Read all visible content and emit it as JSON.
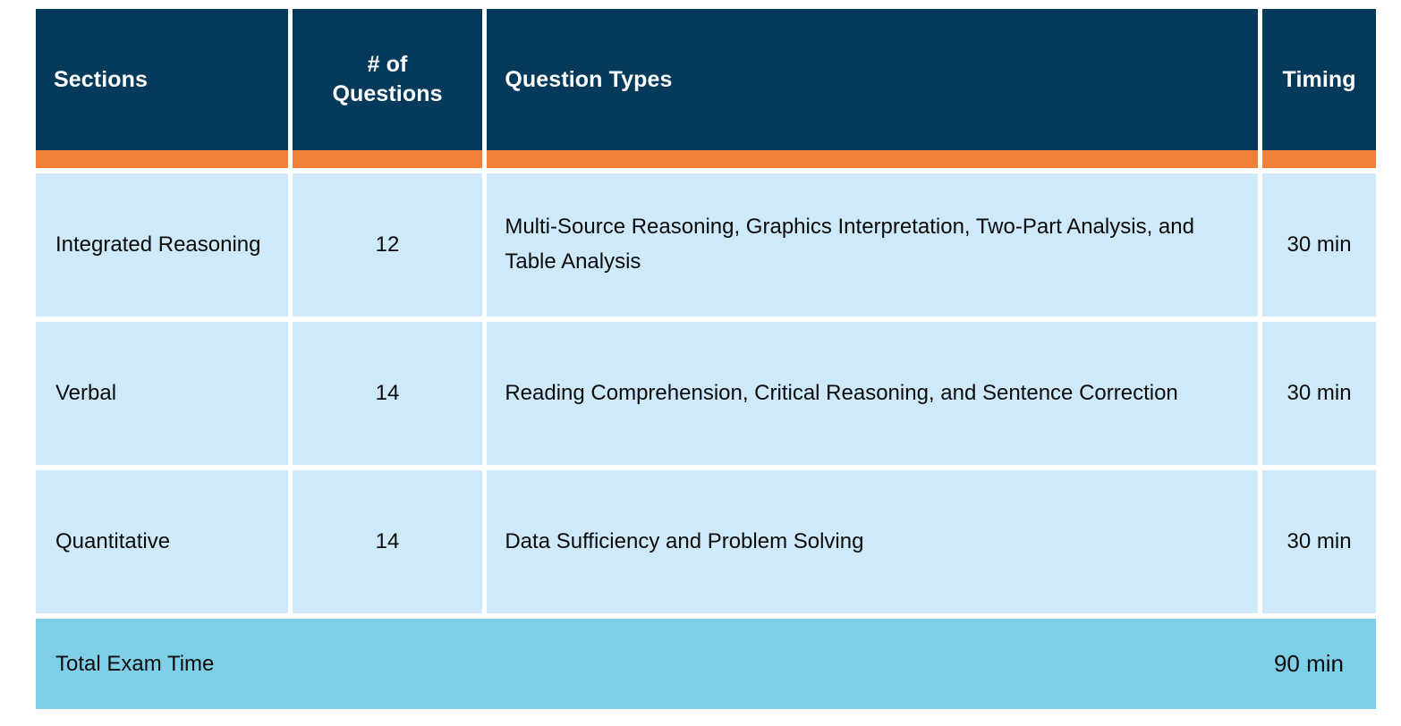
{
  "table": {
    "columns": [
      {
        "key": "sections",
        "label": "Sections"
      },
      {
        "key": "count",
        "label": "# of\nQuestions"
      },
      {
        "key": "types",
        "label": "Question Types"
      },
      {
        "key": "timing",
        "label": "Timing"
      }
    ],
    "header": {
      "sections": "Sections",
      "count_line1": "# of",
      "count_line2": "Questions",
      "types": "Question Types",
      "timing": "Timing"
    },
    "rows": [
      {
        "section": "Integrated Reasoning",
        "questions": "12",
        "question_types": "Multi-Source Reasoning, Graphics Interpretation, Two-Part Analysis, and Table Analysis",
        "timing": "30 min"
      },
      {
        "section": "Verbal",
        "questions": "14",
        "question_types": "Reading Comprehension, Critical Reasoning, and Sentence Correction",
        "timing": "30 min"
      },
      {
        "section": "Quantitative",
        "questions": "14",
        "question_types": "Data Sufficiency and Problem Solving",
        "timing": "30 min"
      }
    ],
    "footer": {
      "label": "Total Exam Time",
      "value": "90 min"
    },
    "colors": {
      "header_background": "#053A5B",
      "header_text": "#FFFFFF",
      "accent_band": "#F08037",
      "cell_background": "#CEE9FA",
      "cell_text": "#0B0B0B",
      "footer_background": "#7ED0E8",
      "page_background": "#FFFFFF"
    }
  }
}
